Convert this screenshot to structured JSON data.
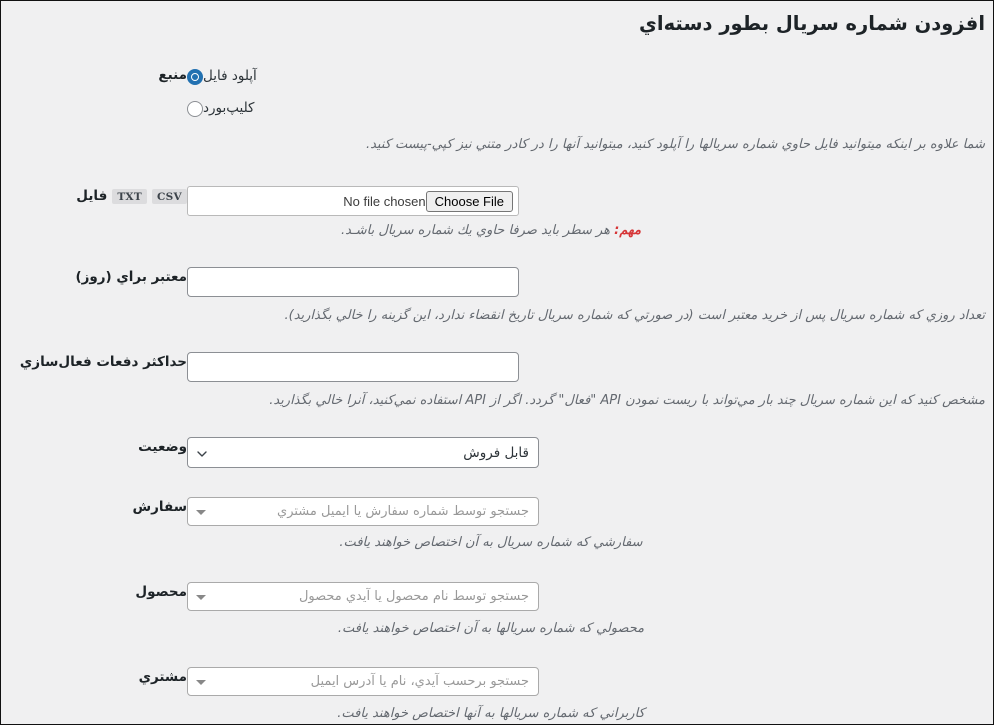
{
  "page": {
    "title": "افزودن شماره سریال بطور دسته‌اي"
  },
  "source": {
    "label": "منبع",
    "options": [
      {
        "label": "آپلود فایل",
        "checked": true
      },
      {
        "label": "کلیپ‌بورد",
        "checked": false
      }
    ],
    "description": "شما علاوه بر اینکه میتوانید فایل حاوي شماره سریالها را آپلود کنید، میتوانید آنها را در کادر متني نیز کپي-پیست کنید."
  },
  "file": {
    "label": "فایل",
    "badges": [
      "TXT",
      "CSV"
    ],
    "button_label": "Choose File",
    "file_status": "No file chosen",
    "note_prefix": "مهم:",
    "note_text": " هر سطر باید صرفا حاوي یك شماره سریال باشـد."
  },
  "valid_for": {
    "label": "معتبر براي (روز)",
    "value": "",
    "description": "تعداد روزي که شماره سریال پس از خرید معتبر است (در صورتي که شماره سریال تاریخ انقضاء ندارد، این گزینه را خالي بگذارید)."
  },
  "max_activations": {
    "label": "حداکثر دفعات فعال‌سازي",
    "value": "",
    "description": "مشخص کنید که این شماره سریال چند بار مي‌تواند با ریست نمودن API \"فعال\" گردد. اگر از API استفاده نمي‌کنید، آنرا خالي بگذارید."
  },
  "status": {
    "label": "وضعیت",
    "selected": "قابل فروش",
    "icon": "chevron-down-icon"
  },
  "order": {
    "label": "سفارش",
    "placeholder": "جستجو توسط شماره سفارش یا ایمیل مشتري",
    "description": "سفارشي که شماره سریال به آن اختصاص خواهند یافت.",
    "icon": "caret-down-icon"
  },
  "product": {
    "label": "محصول",
    "placeholder": "جستجو توسط نام محصول یا آیدي محصول",
    "description": "محصولي که شماره سریالها به آن اختصاص خواهند یافت.",
    "icon": "caret-down-icon"
  },
  "customer": {
    "label": "مشتري",
    "placeholder": "جستجو برحسب آیدي، نام یا آدرس ایمیل",
    "description": "کاربراني که شماره سریالها به آنها اختصاص خواهند یافت.",
    "icon": "caret-down-icon"
  },
  "colors": {
    "background": "#f0f0f1",
    "accent": "#2271b1",
    "danger": "#d63638",
    "text": "#1d2327",
    "muted": "#646970"
  }
}
